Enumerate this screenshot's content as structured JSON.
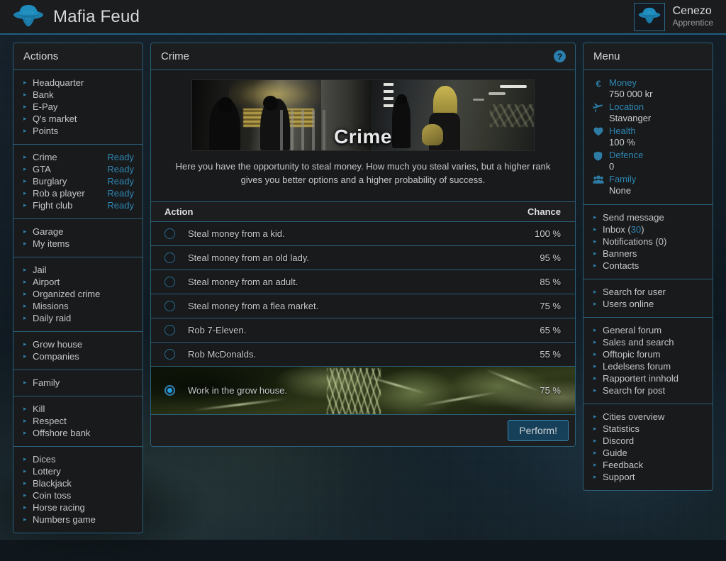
{
  "header": {
    "brand_title": "Mafia Feud",
    "logo_icon": "fedora-hat-icon",
    "user_name": "Cenezo",
    "user_rank": "Apprentice",
    "avatar_icon": "fedora-hat-icon"
  },
  "colors": {
    "accent_blue": "#2f86b4",
    "panel_border": "#2a5f7a",
    "panel_bg": "#181a1b",
    "radio_selected": "#23a0e0",
    "button_fill": "#16405a",
    "button_border": "#3b87b4"
  },
  "sidebar_left": {
    "title": "Actions",
    "groups": [
      {
        "items": [
          {
            "label": "Headquarter"
          },
          {
            "label": "Bank"
          },
          {
            "label": "E-Pay"
          },
          {
            "label": "Q's market"
          },
          {
            "label": "Points"
          }
        ]
      },
      {
        "items": [
          {
            "label": "Crime",
            "status": "Ready"
          },
          {
            "label": "GTA",
            "status": "Ready"
          },
          {
            "label": "Burglary",
            "status": "Ready"
          },
          {
            "label": "Rob a player",
            "status": "Ready"
          },
          {
            "label": "Fight club",
            "status": "Ready"
          }
        ]
      },
      {
        "items": [
          {
            "label": "Garage"
          },
          {
            "label": "My items"
          }
        ]
      },
      {
        "items": [
          {
            "label": "Jail"
          },
          {
            "label": "Airport"
          },
          {
            "label": "Organized crime"
          },
          {
            "label": "Missions"
          },
          {
            "label": "Daily raid"
          }
        ]
      },
      {
        "items": [
          {
            "label": "Grow house"
          },
          {
            "label": "Companies"
          }
        ]
      },
      {
        "items": [
          {
            "label": "Family"
          }
        ]
      },
      {
        "items": [
          {
            "label": "Kill"
          },
          {
            "label": "Respect"
          },
          {
            "label": "Offshore bank"
          }
        ]
      },
      {
        "items": [
          {
            "label": "Dices"
          },
          {
            "label": "Lottery"
          },
          {
            "label": "Blackjack"
          },
          {
            "label": "Coin toss"
          },
          {
            "label": "Horse racing"
          },
          {
            "label": "Numbers game"
          }
        ]
      }
    ]
  },
  "sidebar_right": {
    "title": "Menu",
    "stats": [
      {
        "icon": "euro-icon",
        "label": "Money",
        "value": "750 000 kr"
      },
      {
        "icon": "airplane-icon",
        "label": "Location",
        "value": "Stavanger"
      },
      {
        "icon": "heart-icon",
        "label": "Health",
        "value": "100 %"
      },
      {
        "icon": "shield-icon",
        "label": "Defence",
        "value": "0"
      },
      {
        "icon": "people-group-icon",
        "label": "Family",
        "value": "None"
      }
    ],
    "groups": [
      {
        "items": [
          {
            "label": "Send message"
          },
          {
            "label": "Inbox (",
            "count": "30",
            "label_suffix": ")"
          },
          {
            "label": "Notifications (0)"
          },
          {
            "label": "Banners"
          },
          {
            "label": "Contacts"
          }
        ]
      },
      {
        "items": [
          {
            "label": "Search for user"
          },
          {
            "label": "Users online"
          }
        ]
      },
      {
        "items": [
          {
            "label": "General forum"
          },
          {
            "label": "Sales and search"
          },
          {
            "label": "Offtopic forum"
          },
          {
            "label": "Ledelsens forum"
          },
          {
            "label": "Rapportert innhold"
          },
          {
            "label": "Search for post"
          }
        ]
      },
      {
        "items": [
          {
            "label": "Cities overview"
          },
          {
            "label": "Statistics"
          },
          {
            "label": "Discord"
          },
          {
            "label": "Guide"
          },
          {
            "label": "Feedback"
          },
          {
            "label": "Support"
          }
        ]
      }
    ]
  },
  "main": {
    "title": "Crime",
    "help_icon": "question-mark-circle-icon",
    "banner_label": "Crime",
    "description": "Here you have the opportunity to steal money. How much you steal varies, but a higher rank gives you better options and a higher probability of success.",
    "table": {
      "col_action": "Action",
      "col_chance": "Chance",
      "rows": [
        {
          "label": "Steal money from a kid.",
          "chance": "100 %",
          "selected": false,
          "has_bg": false
        },
        {
          "label": "Steal money from an old lady.",
          "chance": "95 %",
          "selected": false,
          "has_bg": false
        },
        {
          "label": "Steal money from an adult.",
          "chance": "85 %",
          "selected": false,
          "has_bg": false
        },
        {
          "label": "Steal money from a flea market.",
          "chance": "75 %",
          "selected": false,
          "has_bg": false
        },
        {
          "label": "Rob 7-Eleven.",
          "chance": "65 %",
          "selected": false,
          "has_bg": false
        },
        {
          "label": "Rob McDonalds.",
          "chance": "55 %",
          "selected": false,
          "has_bg": false
        },
        {
          "label": "Work in the grow house.",
          "chance": "75 %",
          "selected": true,
          "has_bg": true
        }
      ]
    },
    "perform_label": "Perform!"
  }
}
